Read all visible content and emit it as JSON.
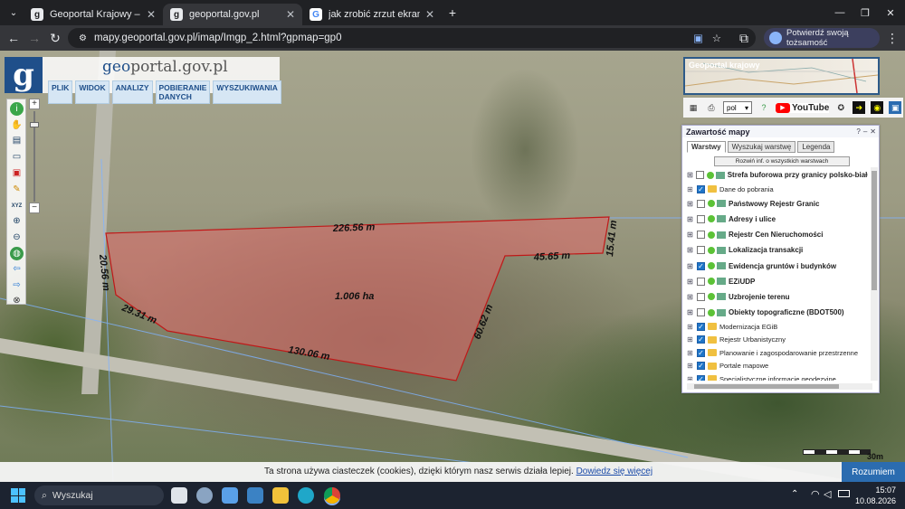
{
  "browser": {
    "tabs": [
      {
        "title": "Geoportal Krajowy – Geoportal",
        "active": false
      },
      {
        "title": "geoportal.gov.pl",
        "active": true
      },
      {
        "title": "jak zrobić zrzut ekranu na kom",
        "active": false
      }
    ],
    "new_tab": "+",
    "url": "mapy.geoportal.gov.pl/imap/Imgp_2.html?gpmap=gp0",
    "identity_label": "Potwierdź swoją tożsamość",
    "win_controls": [
      "—",
      "❐",
      "✕"
    ]
  },
  "portal": {
    "logo_letter": "g",
    "name_prefix": "geo",
    "name_rest": "portal.gov.pl",
    "menu": [
      "PLIK",
      "WIDOK",
      "ANALIZY",
      "POBIERANIE DANYCH",
      "WYSZUKIWANIA"
    ],
    "zoom_in": "+",
    "zoom_out": "−"
  },
  "overview": {
    "caption": "Geoportal krajowy"
  },
  "right_toolbar": {
    "lang": "pol",
    "youtube": "YouTube"
  },
  "panel": {
    "title": "Zawartość mapy",
    "controls": [
      "?",
      "–",
      "✕"
    ],
    "tabs": [
      "Warstwy",
      "Wyszukaj warstwę",
      "Legenda"
    ],
    "expand_btn": "Rozwiń inf. o wszystkich warstwach",
    "layers": [
      {
        "name": "Strefa buforowa przy granicy polsko-białoruskiej",
        "checked": false,
        "kind": "service",
        "bold": true
      },
      {
        "name": "Dane do pobrania",
        "checked": true,
        "kind": "folder",
        "bold": false
      },
      {
        "name": "Państwowy Rejestr Granic",
        "checked": false,
        "kind": "service",
        "bold": true
      },
      {
        "name": "Adresy i ulice",
        "checked": false,
        "kind": "service",
        "bold": true
      },
      {
        "name": "Rejestr Cen Nieruchomości",
        "checked": false,
        "kind": "service",
        "bold": true
      },
      {
        "name": "Lokalizacja transakcji",
        "checked": false,
        "kind": "service",
        "bold": true
      },
      {
        "name": "Ewidencja gruntów i budynków",
        "checked": true,
        "kind": "service",
        "bold": true
      },
      {
        "name": "EZiUDP",
        "checked": false,
        "kind": "service",
        "bold": true
      },
      {
        "name": "Uzbrojenie terenu",
        "checked": false,
        "kind": "service",
        "bold": true
      },
      {
        "name": "Obiekty topograficzne (BDOT500)",
        "checked": false,
        "kind": "service",
        "bold": true
      },
      {
        "name": "Modernizacja EGiB",
        "checked": true,
        "kind": "folder",
        "bold": false
      },
      {
        "name": "Rejestr Urbanistyczny",
        "checked": true,
        "kind": "folder",
        "bold": false
      },
      {
        "name": "Planowanie i zagospodarowanie przestrzenne",
        "checked": true,
        "kind": "folder",
        "bold": false
      },
      {
        "name": "Portale mapowe",
        "checked": true,
        "kind": "folder",
        "bold": false
      },
      {
        "name": "Specjalistyczne informacje geodezyjne",
        "checked": true,
        "kind": "folder",
        "bold": false
      }
    ]
  },
  "measure": {
    "area": "1.006 ha",
    "edges": [
      "226.56 m",
      "15.41 m",
      "45.65 m",
      "60.62 m",
      "130.06 m",
      "29.31 m",
      "20.56 m"
    ],
    "fill": "#e06a6a",
    "stroke": "#c01818"
  },
  "scale": {
    "label": "30m"
  },
  "cookie": {
    "message": "Ta strona używa ciasteczek (cookies), dzięki którym nasz serwis działa lepiej.",
    "link": "Dowiedz się więcej",
    "button": "Rozumiem"
  },
  "taskbar": {
    "search": "Wyszukaj",
    "time": "15:07",
    "date": "10.08.2026"
  }
}
